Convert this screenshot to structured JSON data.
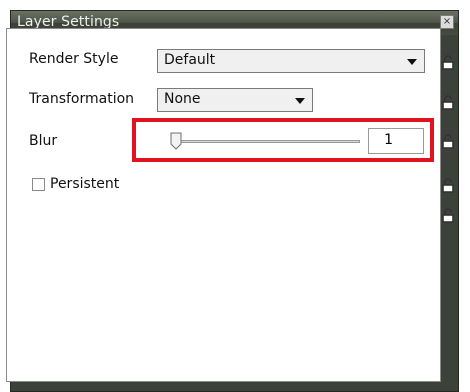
{
  "window": {
    "title": "Layer Settings",
    "close_glyph": "×"
  },
  "fields": {
    "render_style": {
      "label": "Render Style",
      "value": "Default"
    },
    "transformation": {
      "label": "Transformation",
      "value": "None"
    },
    "blur": {
      "label": "Blur",
      "value": "1",
      "slider_level": 0
    },
    "persistent": {
      "label": "Persistent",
      "checked": false
    }
  },
  "icons": {
    "lock": "lock-icon",
    "close": "close-icon",
    "caret": "chevron-down-icon",
    "slider_thumb": "slider-thumb-icon"
  },
  "colors": {
    "highlight": "#e0141e",
    "titlebar": "#4e5447"
  }
}
